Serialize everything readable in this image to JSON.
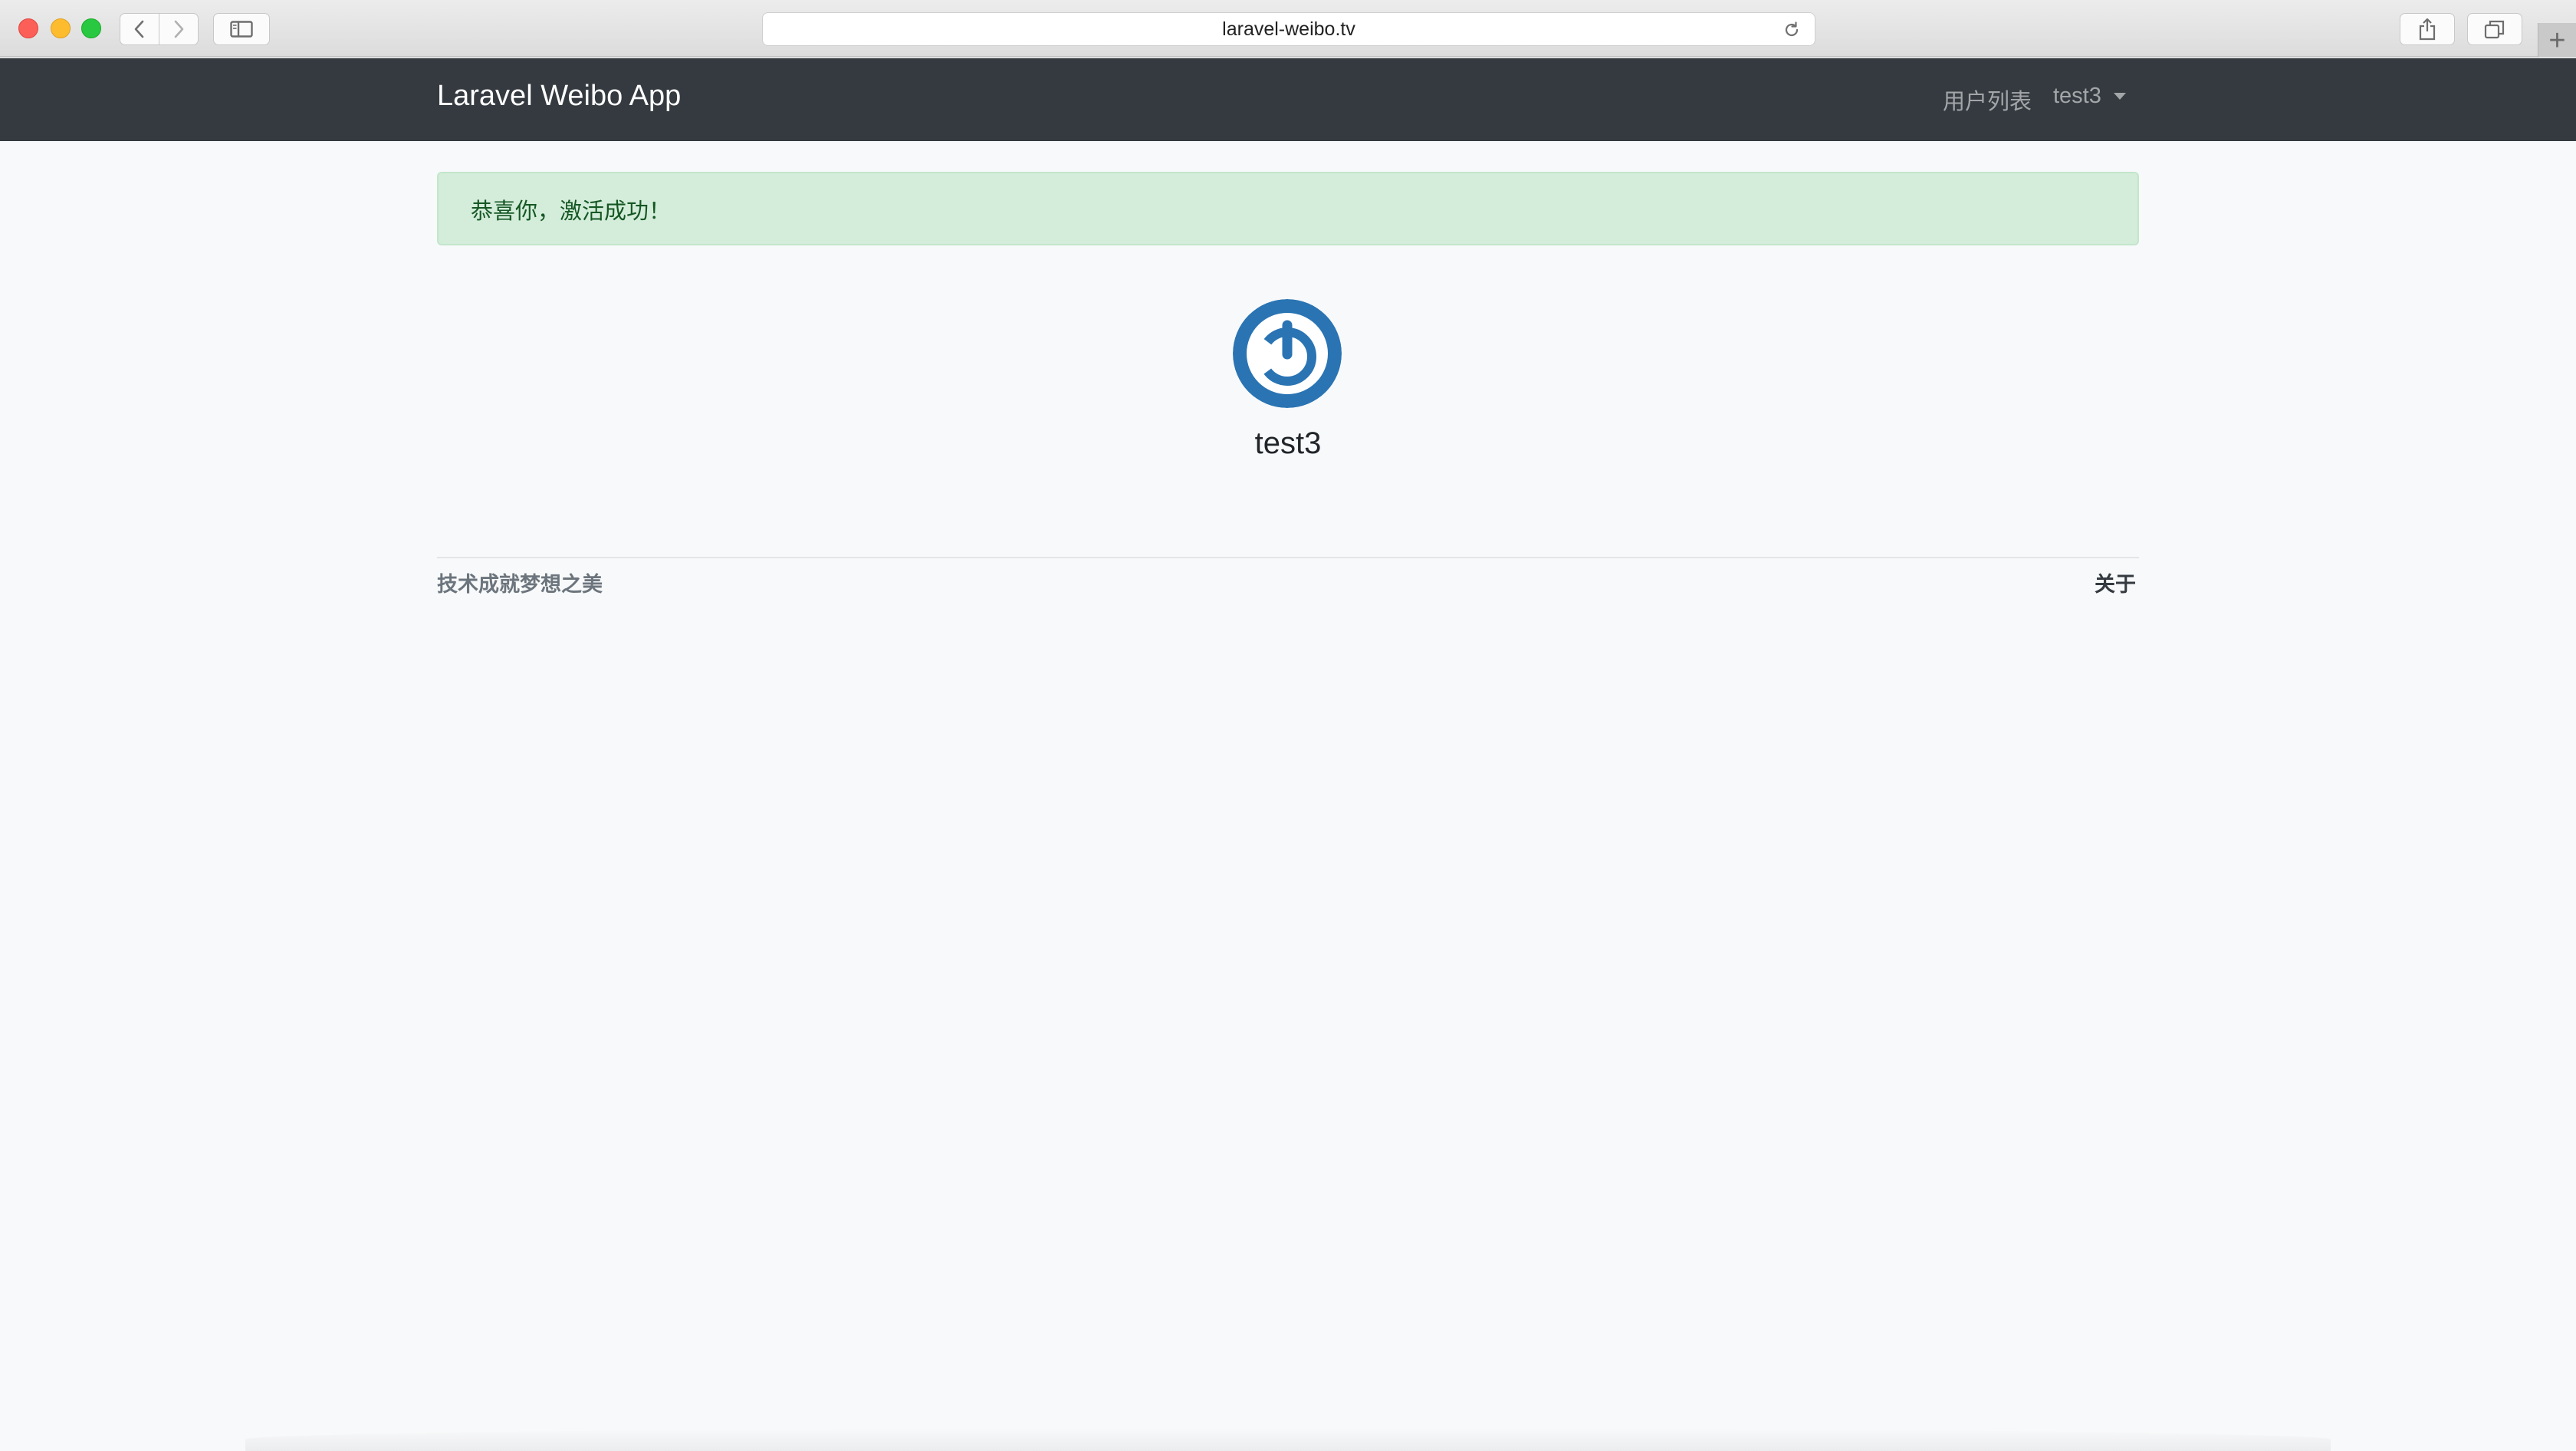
{
  "browser": {
    "url": "laravel-weibo.tv",
    "new_tab_label": "+"
  },
  "navbar": {
    "brand": "Laravel Weibo App",
    "users_link": "用户列表",
    "current_user": "test3",
    "background_color": "#343a40"
  },
  "alert": {
    "message": "恭喜你，激活成功！",
    "type": "success"
  },
  "profile": {
    "username": "test3",
    "avatar_icon": "gravatar-power-icon",
    "avatar_color": "#2a74b3"
  },
  "footer": {
    "slogan": "技术成就梦想之美",
    "about_link": "关于"
  }
}
